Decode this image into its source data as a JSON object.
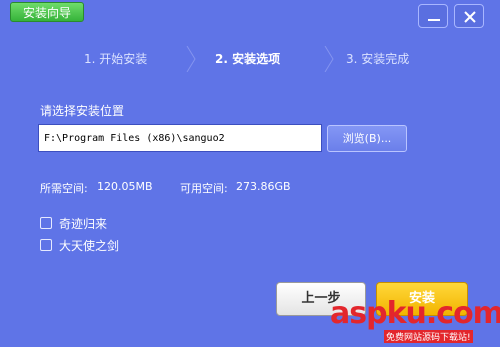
{
  "window": {
    "title": "安装向导"
  },
  "steps": [
    {
      "label": "1. 开始安装",
      "active": false
    },
    {
      "label": "2. 安装选项",
      "active": true
    },
    {
      "label": "3. 安装完成",
      "active": false
    }
  ],
  "location": {
    "label": "请选择安装位置",
    "path_value": "F:\\Program Files (x86)\\sanguo2",
    "browse_label": "浏览(B)..."
  },
  "space": {
    "required_label": "所需空间:",
    "required_value": "120.05MB",
    "available_label": "可用空间:",
    "available_value": "273.86GB"
  },
  "options": [
    {
      "label": "奇迹归来",
      "checked": false
    },
    {
      "label": "大天使之剑",
      "checked": false
    }
  ],
  "buttons": {
    "prev_label": "上一步",
    "install_label": "安装"
  },
  "watermark": {
    "brand_text": "aspku.com",
    "sub_text": "免费网站源码下载站!"
  },
  "colors": {
    "window_bg": "#5f74e7",
    "title_tab": "#36b33a",
    "install_button": "#f2b400",
    "watermark_red": "#e3262c"
  }
}
